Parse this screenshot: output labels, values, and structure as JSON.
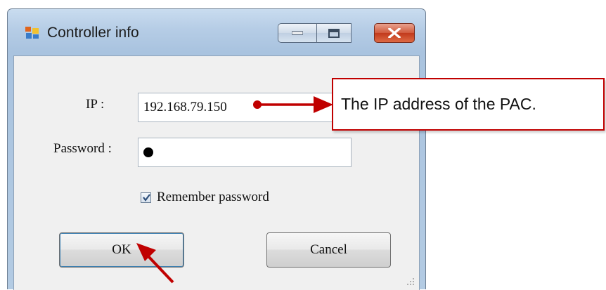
{
  "window": {
    "title": "Controller info",
    "controls": {
      "minimize": "minimize",
      "maximize": "maximize",
      "close": "close"
    }
  },
  "form": {
    "ip_label": "IP :",
    "ip_value": "192.168.79.150",
    "password_label": "Password :",
    "remember_label": "Remember password",
    "remember_checked": true,
    "ok_label": "OK",
    "cancel_label": "Cancel"
  },
  "annotation": {
    "callout_text": "The IP address of the PAC.",
    "accent_color": "#c00000"
  },
  "icons": [
    "app-icon",
    "minimize-icon",
    "maximize-icon",
    "close-icon",
    "checkmark-icon",
    "resize-grip-icon"
  ]
}
